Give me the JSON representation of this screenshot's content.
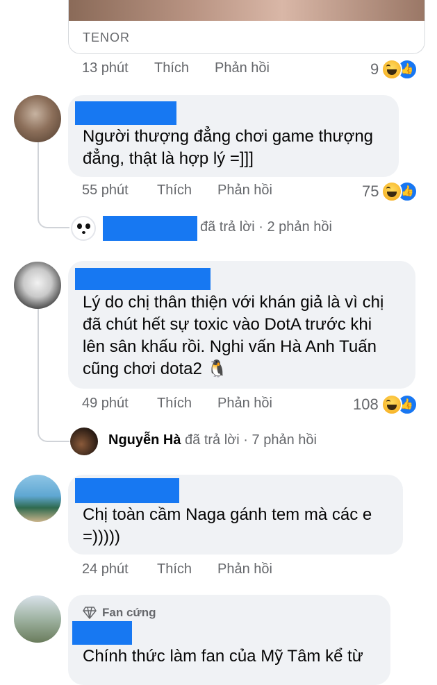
{
  "gif": {
    "source": "TENOR"
  },
  "actions": {
    "like": "Thích",
    "reply": "Phản hồi"
  },
  "comments": [
    {
      "time": "13 phút",
      "react_count": "9"
    },
    {
      "text": "Người thượng đẳng chơi game thượng đẳng, thật là hợp lý =]]]",
      "time": "55 phút",
      "react_count": "75",
      "reply_summary": {
        "verb": "đã trả lời",
        "count": "2 phản hồi"
      }
    },
    {
      "text_lines": [
        "Lý do chị thân thiện với khán giả là vì chị",
        "đã chút hết sự toxic vào DotA trước khi",
        "lên sân khấu rồi. Nghi vấn Hà Anh Tuấn",
        "cũng chơi dota2"
      ],
      "emoji": "🐧",
      "time": "49 phút",
      "react_count": "108",
      "reply_summary": {
        "name": "Nguyễn Hà",
        "verb": "đã trả lời",
        "count": "7 phản hồi"
      }
    },
    {
      "text_lines": [
        "Chị toàn cầm Naga gánh tem mà các e",
        "=)))))"
      ],
      "time": "24 phút"
    },
    {
      "badge": "Fan cứng",
      "text": "Chính thức làm fan của Mỹ Tâm kể từ"
    }
  ],
  "separator": "·",
  "icons": {
    "haha": "haha-reaction-icon",
    "like": "like-reaction-icon",
    "badge": "diamond-icon"
  },
  "colors": {
    "accent": "#1877f2",
    "redaction": "#1778f2",
    "bubble": "#f0f2f5",
    "meta": "#65676b"
  }
}
